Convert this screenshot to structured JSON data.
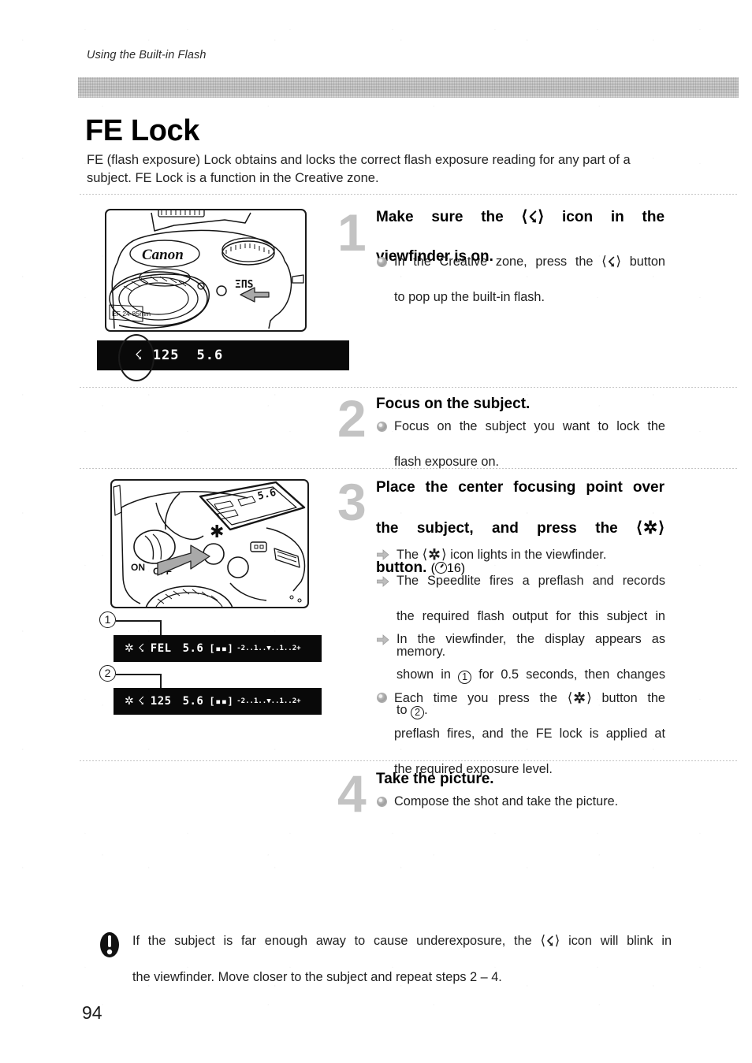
{
  "document": {
    "running_head": "Using the Built-in Flash",
    "title": "FE Lock",
    "intro_line1": "FE (flash exposure) Lock obtains and locks the correct flash exposure reading for any part of",
    "intro_line2": "a subject. FE Lock is a function in the Creative zone.",
    "page_number": "94"
  },
  "icons": {
    "flash_bolt": "⚡",
    "bolt_glyph": "☇",
    "star_glyph": "✲",
    "angle_open": "⟨",
    "angle_close": "⟩",
    "timer_label": "16"
  },
  "steps": [
    {
      "number": "1",
      "title_line1_pre": "Make  sure  the",
      "title_line1_post": "icon  in  the",
      "title_line2": "viewfinder is on.",
      "bullets": [
        {
          "marker": "dot",
          "line1_pre": "In the Creative zone, press the",
          "line1_post": "button",
          "line2": "to pop up the built-in flash."
        }
      ],
      "figure": {
        "camera_labels": {
          "brand": "Canon",
          "system": "EOS",
          "lens": "EF 24-85mm"
        },
        "viewfinder": {
          "shutter": "125",
          "aperture": "5.6"
        }
      }
    },
    {
      "number": "2",
      "title_line1": "Focus on the subject.",
      "bullets": [
        {
          "marker": "dot",
          "line1": "Focus on the subject you want to lock the",
          "line2": "flash exposure on."
        }
      ]
    },
    {
      "number": "3",
      "title_line1": "Place the center focusing point over",
      "title_line2_pre": "the  subject,  and  press  the",
      "title_line3_pre": "button.",
      "title_ref_open": "(",
      "title_ref_close": ")",
      "bullets": [
        {
          "marker": "arrow",
          "line1_pre": "The",
          "line1_post": "icon lights in the viewfinder."
        },
        {
          "marker": "arrow",
          "line1": "The Speedlite fires a preflash and records",
          "line2": "the required flash output for this subject in",
          "line3": "memory."
        },
        {
          "marker": "arrow",
          "line1": "In the viewfinder, the display appears as",
          "line2_a": "shown in",
          "line2_num": "1",
          "line2_b": "for 0.5 seconds, then changes",
          "line3_a": "to",
          "line3_num": "2",
          "line3_b": "."
        },
        {
          "marker": "dot",
          "line1_pre": "Each time you press the",
          "line1_post": "button the",
          "line2": "preflash fires, and the FE lock is applied at",
          "line3": "the required exposure level."
        }
      ],
      "figure": {
        "camera_labels": {
          "power_on": "ON",
          "power_off": "OFF",
          "lcd_aperture": "5.6"
        },
        "callouts": [
          {
            "label": "1"
          },
          {
            "label": "2"
          }
        ],
        "viewfinder_1": {
          "mode": "FEL",
          "aperture": "5.6",
          "scale": "-2..1..▼..1..2+"
        },
        "viewfinder_2": {
          "shutter": "125",
          "aperture": "5.6",
          "scale": "-2..1..▼..1..2+"
        }
      }
    },
    {
      "number": "4",
      "title_line1": "Take the picture.",
      "bullets": [
        {
          "marker": "dot",
          "line1": "Compose the shot and take the picture."
        }
      ]
    }
  ],
  "note": {
    "line1_pre": "If the subject is far enough away to cause underexposure, the",
    "line1_post": "icon will blink in",
    "line2": "the viewfinder. Move closer to the subject and repeat steps 2 – 4."
  },
  "colors": {
    "ink": "#1a1a1a",
    "band": "#d0d0d0",
    "step_number": "#c3c3c3",
    "lcd_background": "#090909",
    "lcd_text": "#ffffff"
  }
}
